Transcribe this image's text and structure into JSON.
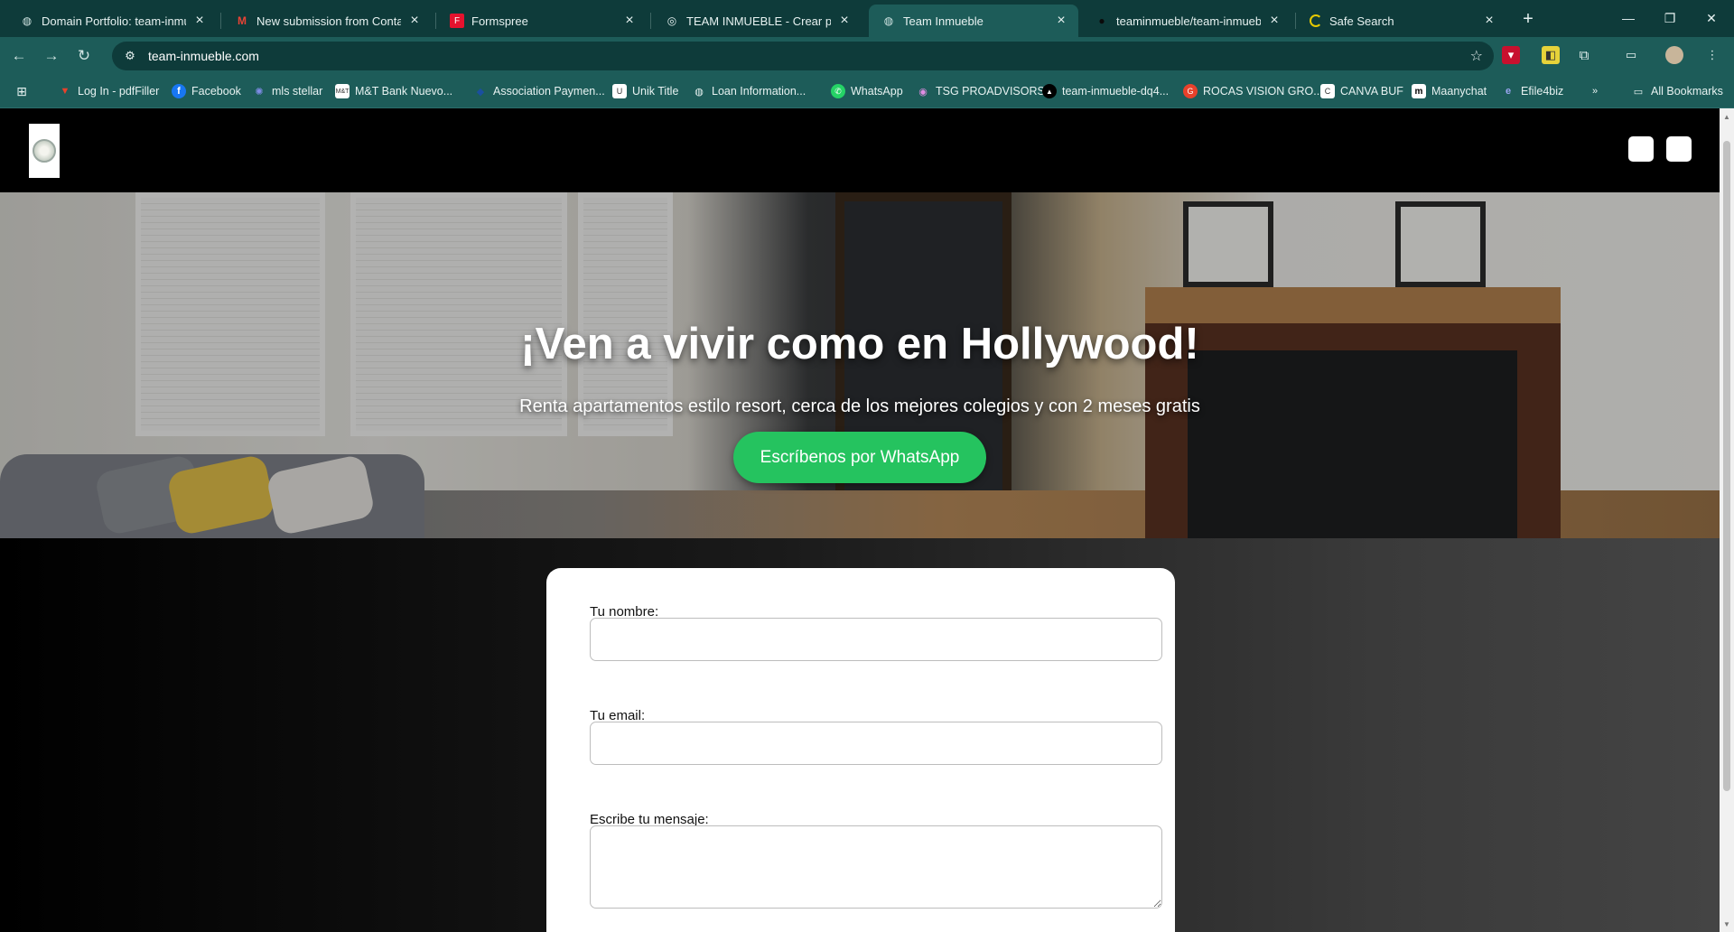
{
  "browser": {
    "tabs": [
      {
        "title": "Domain Portfolio: team-inmueble",
        "icon": "globe-icon",
        "active": false
      },
      {
        "title": "New submission from Contacto",
        "icon": "gmail-icon",
        "active": false
      },
      {
        "title": "Formspree",
        "icon": "formspree-icon",
        "active": false
      },
      {
        "title": "TEAM INMUEBLE - Crear página",
        "icon": "site-builder-icon",
        "active": false
      },
      {
        "title": "Team Inmueble",
        "icon": "globe-icon",
        "active": true
      },
      {
        "title": "teaminmueble/team-inmueble",
        "icon": "github-icon",
        "active": false
      },
      {
        "title": "Safe Search",
        "icon": "loading-icon",
        "active": false
      }
    ],
    "address": "team-inmueble.com",
    "bookmarks": [
      {
        "label": "Log In - pdfFiller",
        "icon": "pdffiller-icon",
        "color": "#e8412b"
      },
      {
        "label": "Facebook",
        "icon": "facebook-icon",
        "color": "#1877f2"
      },
      {
        "label": "mls stellar",
        "icon": "stellar-icon",
        "color": "#5b6bd6"
      },
      {
        "label": "M&T Bank Nuevo...",
        "icon": "mtbank-icon",
        "color": "#ffffff"
      },
      {
        "label": "Association Paymen...",
        "icon": "association-icon",
        "color": "#1a4fa0"
      },
      {
        "label": "Unik Title",
        "icon": "unik-icon",
        "color": "#ffffff"
      },
      {
        "label": "Loan Information...",
        "icon": "globe-icon",
        "color": "#e7f2f1"
      },
      {
        "label": "WhatsApp",
        "icon": "whatsapp-icon",
        "color": "#25d366"
      },
      {
        "label": "TSG PROADVISORS",
        "icon": "tsg-icon",
        "color": "#b06ab3"
      },
      {
        "label": "team-inmueble-dq4...",
        "icon": "vercel-icon",
        "color": "#000000"
      },
      {
        "label": "ROCAS VISION GRO...",
        "icon": "rocas-icon",
        "color": "#e8412b"
      },
      {
        "label": "CANVA BUF",
        "icon": "canva-icon",
        "color": "#ffffff"
      },
      {
        "label": "Maanychat",
        "icon": "manychat-icon",
        "color": "#ffffff"
      },
      {
        "label": "Efile4biz",
        "icon": "efile-icon",
        "color": "#5b6bd6"
      }
    ],
    "all_bookmarks": "All Bookmarks"
  },
  "page": {
    "hero": {
      "title": "¡Ven a vivir como en Hollywood!",
      "subtitle": "Renta apartamentos estilo resort, cerca de los mejores colegios y con 2 meses gratis",
      "cta": "Escríbenos por WhatsApp"
    },
    "form": {
      "name_label": "Tu nombre:",
      "name_value": "",
      "email_label": "Tu email:",
      "email_value": "",
      "message_label": "Escribe tu mensaje:",
      "message_value": ""
    },
    "colors": {
      "cta_green": "#25c35f",
      "header_bg": "#000000",
      "chrome_teal": "#1d5c59"
    }
  }
}
